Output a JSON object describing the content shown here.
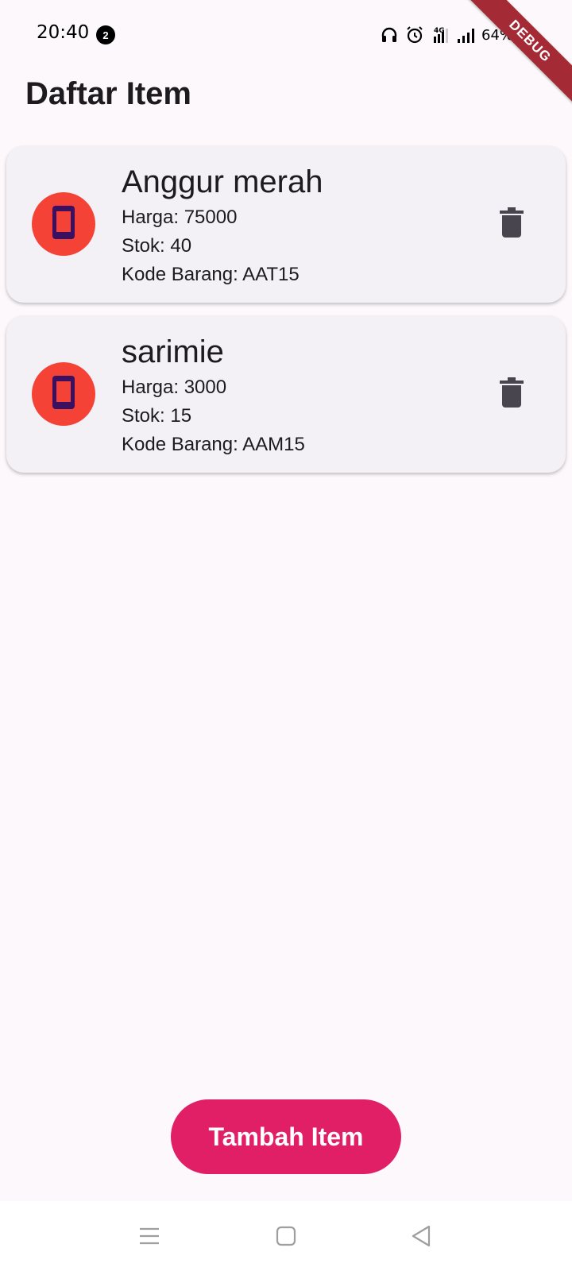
{
  "status_bar": {
    "time": "20:40",
    "notification_count": "2",
    "battery": "64%",
    "icons": [
      "headphones-icon",
      "alarm-icon",
      "4g-signal-icon",
      "signal-icon",
      "battery-charging-icon"
    ]
  },
  "debug_banner": "DEBUG",
  "page": {
    "title": "Daftar Item"
  },
  "items": [
    {
      "name": "Anggur merah",
      "price": "Harga: 75000",
      "stock": "Stok: 40",
      "code": "Kode Barang: AAT15",
      "icon": "phone-icon"
    },
    {
      "name": "sarimie",
      "price": "Harga: 3000",
      "stock": "Stok: 15",
      "code": "Kode Barang: AAM15",
      "icon": "phone-icon"
    }
  ],
  "actions": {
    "add_label": "Tambah Item"
  },
  "colors": {
    "accent": "#e11f66",
    "avatar": "#f44336",
    "card": "#f3f0f6",
    "background": "#fdf8fc"
  },
  "nav": [
    "menu-icon",
    "home-icon",
    "back-icon"
  ]
}
